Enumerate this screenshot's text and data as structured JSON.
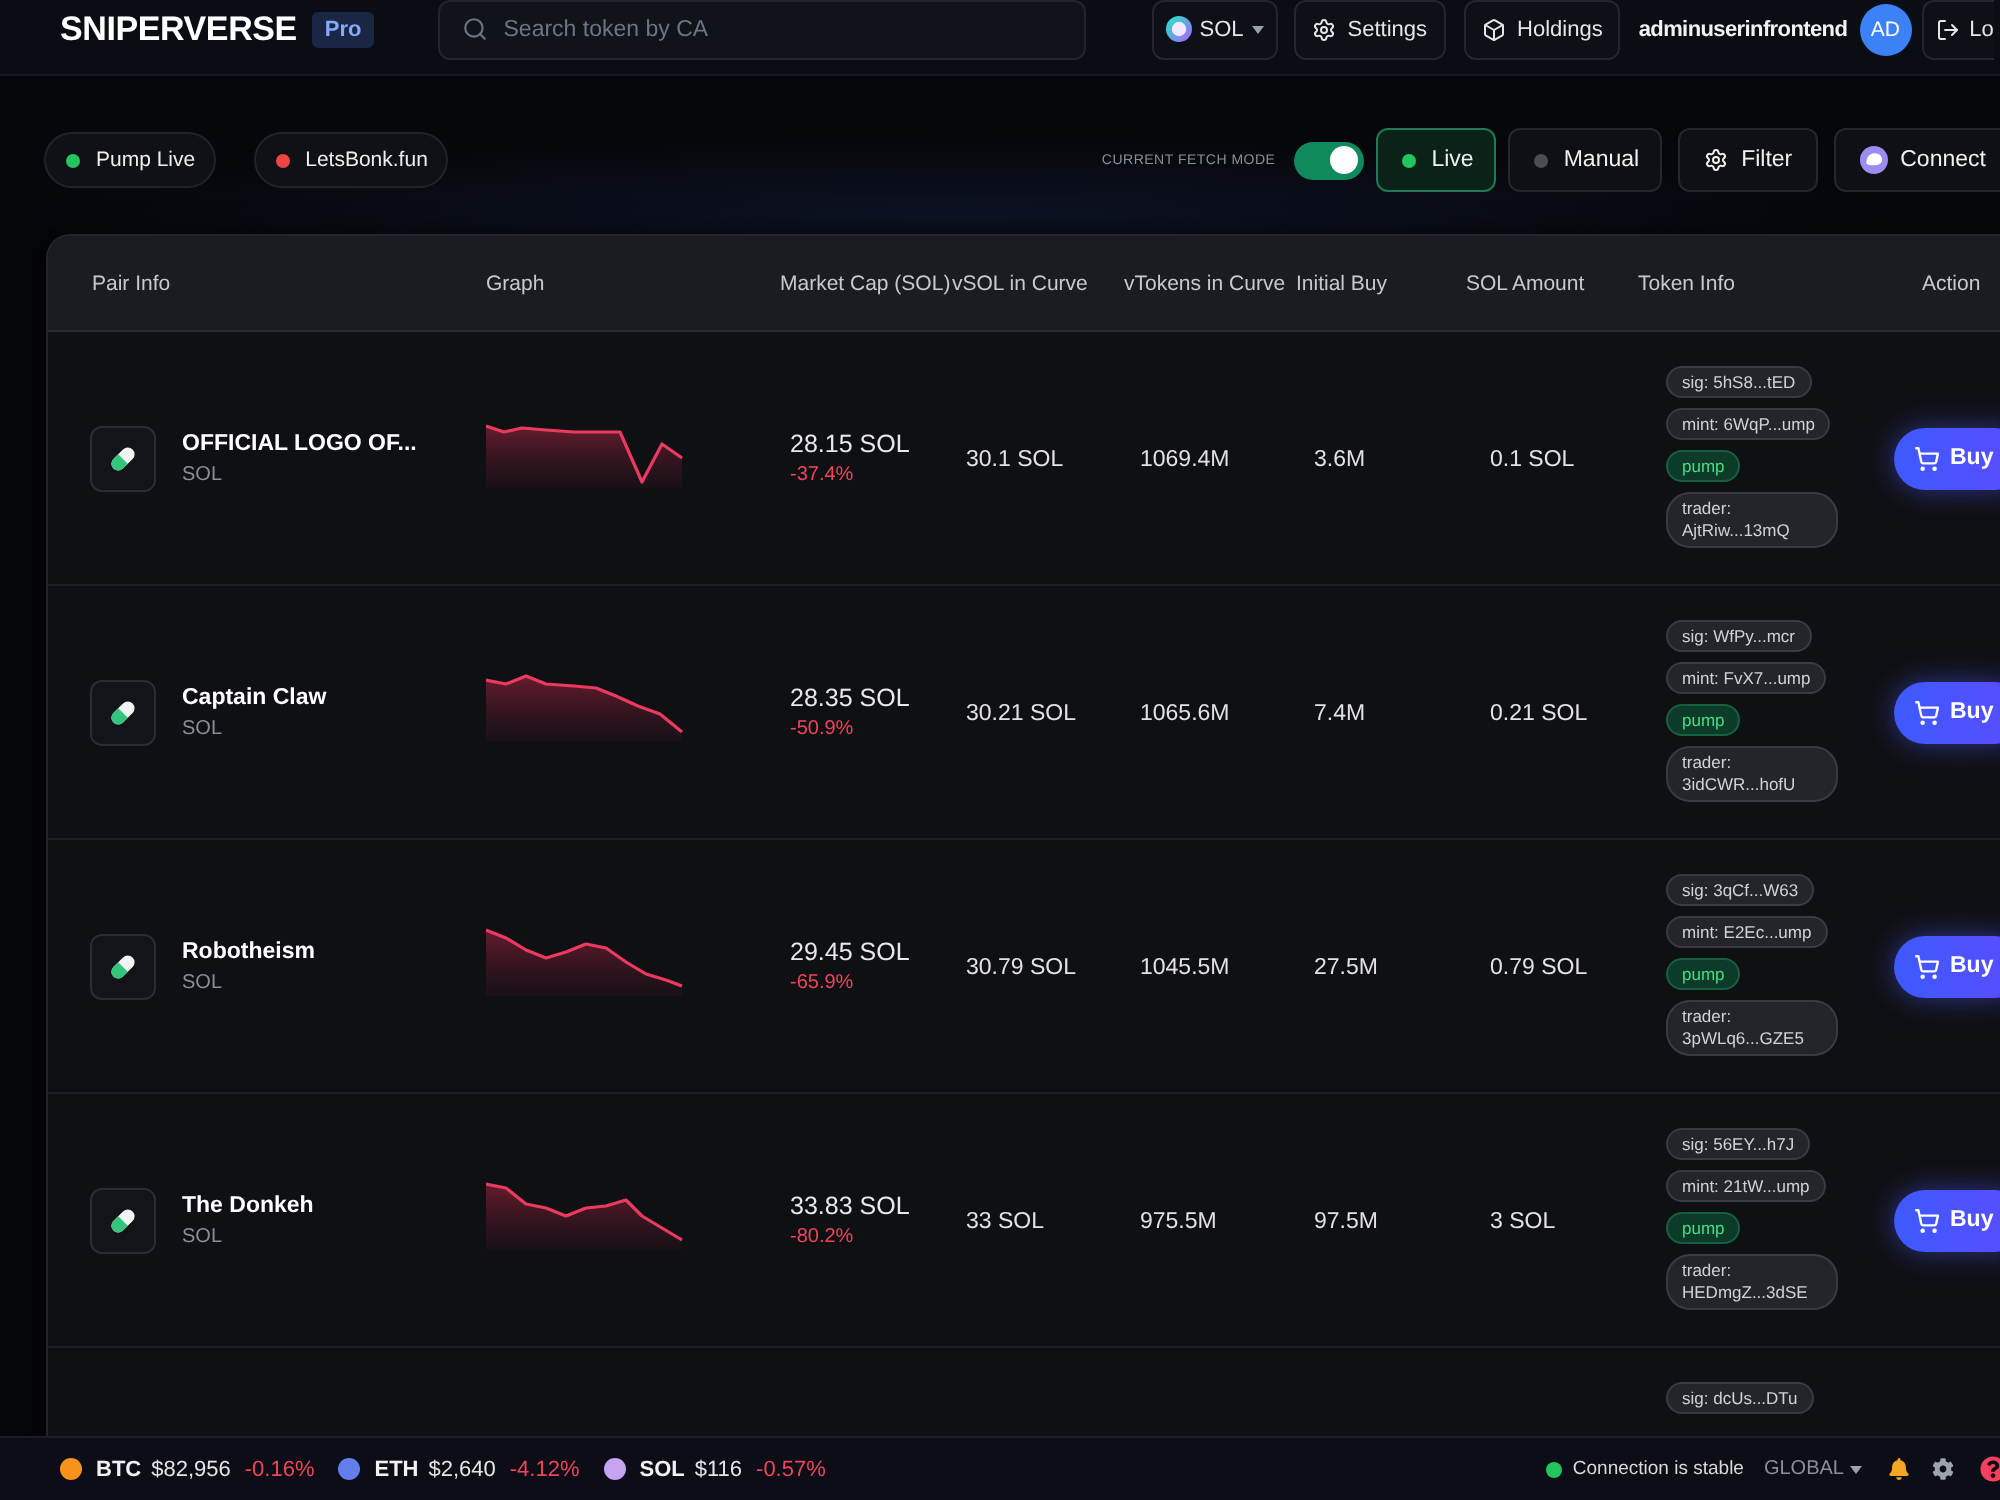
{
  "header": {
    "logo": "SNIPERVERSE",
    "badge": "Pro",
    "search": {
      "placeholder": "Search token by CA"
    },
    "network": {
      "label": "SOL"
    },
    "buttons": [
      {
        "kind": "settings",
        "label": "Settings"
      },
      {
        "kind": "holdings",
        "label": "Holdings"
      }
    ],
    "username": "adminuserinfrontend",
    "avatar": "AD",
    "logout": "Lo"
  },
  "feeds": [
    {
      "label": "Pump Live",
      "color": "#22c55e"
    },
    {
      "label": "LetsBonk.fun",
      "color": "#ef4444"
    }
  ],
  "fetch_mode": {
    "label": "CURRENT FETCH MODE",
    "on": true,
    "modes": [
      {
        "label": "Live",
        "selected": true
      },
      {
        "label": "Manual",
        "selected": false
      }
    ]
  },
  "filter_button": "Filter",
  "connect_button": "Connect",
  "table": {
    "columns": [
      "Pair Info",
      "Graph",
      "Market Cap (SOL)",
      "vSOL in Curve",
      "vTokens in Curve",
      "Initial Buy",
      "SOL Amount",
      "Token Info",
      "Action"
    ],
    "rows": [
      {
        "pair": {
          "name": "OFFICIAL LOGO OF...",
          "symbol": "SOL"
        },
        "market_cap": "28.15 SOL",
        "change": "-37.4%",
        "vsol": "30.1 SOL",
        "vtokens": "1069.4M",
        "initial_buy": "3.6M",
        "sol_amount": "0.1 SOL",
        "token_info": [
          {
            "kind": "sig",
            "text": "sig: 5hS8...tED"
          },
          {
            "kind": "mint",
            "text": "mint: 6WqP...ump"
          },
          {
            "kind": "platform",
            "text": "pump"
          },
          {
            "kind": "trader",
            "text": "trader: AjtRiw...13mQ"
          }
        ],
        "action": "Buy"
      },
      {
        "pair": {
          "name": "Captain Claw",
          "symbol": "SOL"
        },
        "market_cap": "28.35 SOL",
        "change": "-50.9%",
        "vsol": "30.21 SOL",
        "vtokens": "1065.6M",
        "initial_buy": "7.4M",
        "sol_amount": "0.21 SOL",
        "token_info": [
          {
            "kind": "sig",
            "text": "sig: WfPy...mcr"
          },
          {
            "kind": "mint",
            "text": "mint: FvX7...ump"
          },
          {
            "kind": "platform",
            "text": "pump"
          },
          {
            "kind": "trader",
            "text": "trader: 3idCWR...hofU"
          }
        ],
        "action": "Buy"
      },
      {
        "pair": {
          "name": "Robotheism",
          "symbol": "SOL"
        },
        "market_cap": "29.45 SOL",
        "change": "-65.9%",
        "vsol": "30.79 SOL",
        "vtokens": "1045.5M",
        "initial_buy": "27.5M",
        "sol_amount": "0.79 SOL",
        "token_info": [
          {
            "kind": "sig",
            "text": "sig: 3qCf...W63"
          },
          {
            "kind": "mint",
            "text": "mint: E2Ec...ump"
          },
          {
            "kind": "platform",
            "text": "pump"
          },
          {
            "kind": "trader",
            "text": "trader: 3pWLq6...GZE5"
          }
        ],
        "action": "Buy"
      },
      {
        "pair": {
          "name": "The Donkeh",
          "symbol": "SOL"
        },
        "market_cap": "33.83 SOL",
        "change": "-80.2%",
        "vsol": "33 SOL",
        "vtokens": "975.5M",
        "initial_buy": "97.5M",
        "sol_amount": "3 SOL",
        "token_info": [
          {
            "kind": "sig",
            "text": "sig: 56EY...h7J"
          },
          {
            "kind": "mint",
            "text": "mint: 21tW...ump"
          },
          {
            "kind": "platform",
            "text": "pump"
          },
          {
            "kind": "trader",
            "text": "trader: HEDmgZ...3dSE"
          }
        ],
        "action": "Buy"
      },
      {
        "token_info": [
          {
            "kind": "sig",
            "text": "sig: dcUs...DTu"
          }
        ]
      }
    ]
  },
  "status_bar": {
    "tickers": [
      {
        "symbol": "BTC",
        "price": "$82,956",
        "change": "-0.16%",
        "color": "#f7931a"
      },
      {
        "symbol": "ETH",
        "price": "$2,640",
        "change": "-4.12%",
        "color": "#627eea"
      },
      {
        "symbol": "SOL",
        "price": "$116",
        "change": "-0.57%",
        "color": "#c6a4f2"
      }
    ],
    "connected": true,
    "connection": "Connection is stable",
    "region": "GLOBAL"
  }
}
